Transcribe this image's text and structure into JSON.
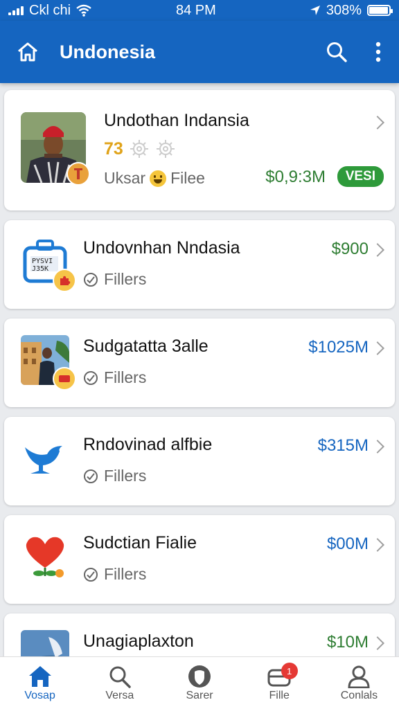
{
  "status_bar": {
    "carrier": "Ckl chi",
    "time": "84 PM",
    "battery": "308%",
    "battery_level": 0.95
  },
  "app_bar": {
    "title": "Undonesia",
    "home_icon": "home-icon",
    "search_icon": "search-icon",
    "menu_icon": "more-vert-icon"
  },
  "featured": {
    "title": "Undothan Indansia",
    "rating": "73",
    "author": "Uksar",
    "author_suffix": "Filee",
    "price": "$0,9:3M",
    "badge": "VESI",
    "colors": {
      "price": "#2e7d32",
      "badge": "#2e9a3a",
      "rating": "#e0a31a"
    }
  },
  "items": [
    {
      "title": "Undovnhan Nndasia",
      "subtitle": "Fillers",
      "price": "$900",
      "price_color": "#2e7d32",
      "icon": "bag-icon"
    },
    {
      "title": "Sudgatatta 3alle",
      "subtitle": "Fillers",
      "price": "$1025M",
      "price_color": "#1565c0",
      "icon": "photo-thumb"
    },
    {
      "title": "Rndovinad alfbie",
      "subtitle": "Fillers",
      "price": "$315M",
      "price_color": "#1565c0",
      "icon": "bird-icon"
    },
    {
      "title": "Sudctian Fialie",
      "subtitle": "Fillers",
      "price": "$00M",
      "price_color": "#1565c0",
      "icon": "heart-flower-icon"
    },
    {
      "title": "Unagiaplaxton",
      "subtitle": "",
      "price": "$10M",
      "price_color": "#2e7d32",
      "icon": "photo-thumb"
    }
  ],
  "bottom_nav": [
    {
      "label": "Vosap",
      "icon": "home-icon",
      "active": true
    },
    {
      "label": "Versa",
      "icon": "search-icon",
      "active": false
    },
    {
      "label": "Sarer",
      "icon": "shield-icon",
      "active": false
    },
    {
      "label": "Fille",
      "icon": "wallet-icon",
      "active": false,
      "badge": "1"
    },
    {
      "label": "Conlals",
      "icon": "person-icon",
      "active": false
    }
  ]
}
